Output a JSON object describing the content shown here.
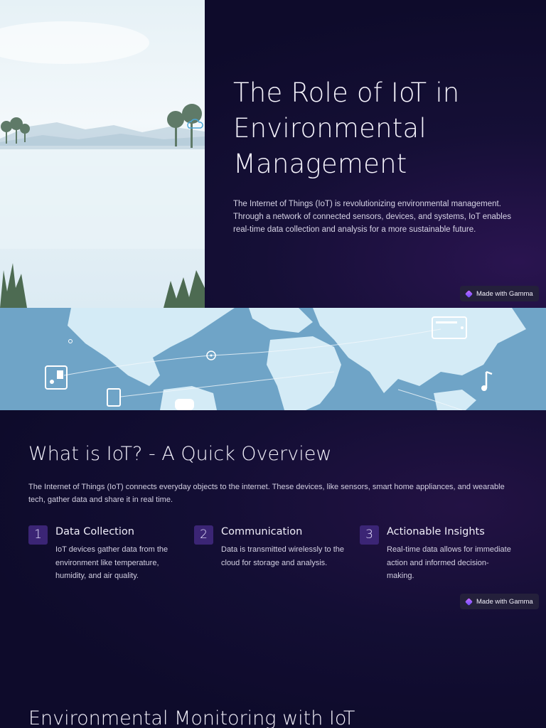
{
  "slide1": {
    "title": "The Role of IoT in Environmental Management",
    "paragraph": "The Internet of Things (IoT) is revolutionizing environmental management. Through a network of connected sensors, devices, and systems, IoT enables real-time data collection and analysis for a more sustainable future.",
    "badge": "Made with Gamma"
  },
  "slide2": {
    "title": "What is IoT? - A Quick Overview",
    "paragraph": "The Internet of Things (IoT) connects everyday objects to the internet. These devices, like sensors, smart home appliances, and wearable tech, gather data and share it in real time.",
    "cards": [
      {
        "number": "1",
        "title": "Data Collection",
        "description": "IoT devices gather data from the environment like temperature, humidity, and air quality."
      },
      {
        "number": "2",
        "title": "Communication",
        "description": "Data is transmitted wirelessly to the cloud for storage and analysis."
      },
      {
        "number": "3",
        "title": "Actionable Insights",
        "description": "Real-time data allows for immediate action and informed decision-making."
      }
    ],
    "badge": "Made with Gamma"
  },
  "slide3": {
    "title": "Environmental Monitoring with IoT"
  },
  "colors": {
    "background": "#0e0b2b",
    "number_box": "#3b2575",
    "map_water": "#7fb0cf",
    "map_land": "#d9eef8"
  },
  "icons": [
    "cloud-icon",
    "gamma-logo-icon",
    "phone-device-icon",
    "tablet-device-icon",
    "monitor-device-icon",
    "music-note-icon",
    "location-pin-icon"
  ]
}
